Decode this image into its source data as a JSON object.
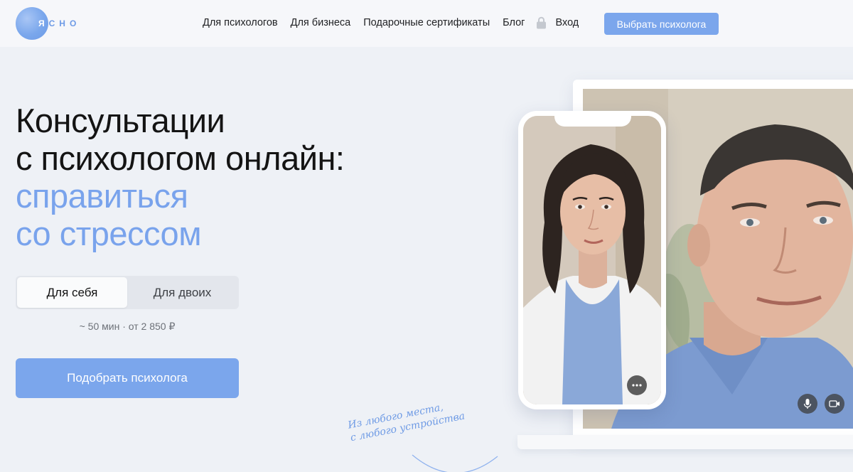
{
  "logo": {
    "first_letter": "Я",
    "rest": "СНО"
  },
  "nav": [
    {
      "label": "Для психологов"
    },
    {
      "label": "Для бизнеса"
    },
    {
      "label": "Подарочные сертификаты"
    },
    {
      "label": "Блог"
    }
  ],
  "login_label": "Вход",
  "header_cta": "Выбрать психолога",
  "hero": {
    "title_line1": "Консультации",
    "title_line2": "с психологом онлайн:",
    "accent_line1": "справиться",
    "accent_line2": "со стрессом"
  },
  "toggle": {
    "options": [
      "Для себя",
      "Для двоих"
    ],
    "selected": "Для себя"
  },
  "meta": "~ 50 мин · от 2 850 ₽",
  "main_cta": "Подобрать психолога",
  "handnote": {
    "line1": "Из любого места,",
    "line2": "с любого устройства"
  },
  "colors": {
    "accent": "#7ba6ec",
    "background": "#eef1f6"
  },
  "icons": [
    "lock-icon",
    "more-icon",
    "microphone-icon",
    "camera-icon"
  ]
}
